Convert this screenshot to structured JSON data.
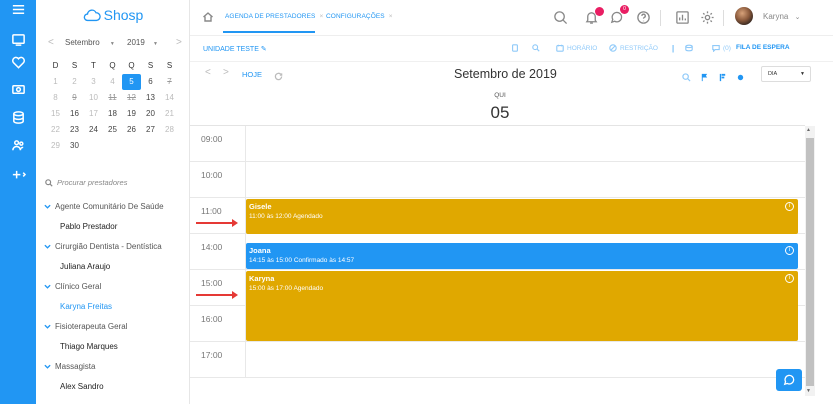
{
  "app": {
    "logo_text": "Shosp",
    "brand_color": "#2196f3"
  },
  "tabs": [
    {
      "label": "AGENDA DE PRESTADORES",
      "close": "×",
      "active": true
    },
    {
      "label": "CONFIGURAÇÕES",
      "close": "×",
      "active": false
    }
  ],
  "user": {
    "name": "Karyna",
    "caret": "⌄"
  },
  "badges": {
    "notifications": "",
    "messages": "0"
  },
  "toolbar": {
    "unit": "UNIDADE TESTE",
    "horario": "HORÁRIO",
    "restricao": "RESTRIÇÃO",
    "sep": "|",
    "waitlist_count": "(0)",
    "fila": "FILA DE ESPERA"
  },
  "nav": {
    "prev": "<",
    "next": ">",
    "today": "HOJE",
    "title": "Setembro de 2019",
    "view": "DIA",
    "view_caret": "▼"
  },
  "day": {
    "dow": "QUI",
    "num": "05"
  },
  "mini_cal": {
    "prev": "<",
    "next": ">",
    "month": "Setembro",
    "month_caret": "▼",
    "year": "2019",
    "year_caret": "▼",
    "dows": [
      "D",
      "S",
      "T",
      "Q",
      "Q",
      "S",
      "S"
    ],
    "weeks": [
      [
        "1",
        "2",
        "3",
        "4",
        "5",
        "6",
        "7"
      ],
      [
        "8",
        "9",
        "10",
        "11",
        "12",
        "13",
        "14"
      ],
      [
        "15",
        "16",
        "17",
        "18",
        "19",
        "20",
        "21"
      ],
      [
        "22",
        "23",
        "24",
        "25",
        "26",
        "27",
        "28"
      ],
      [
        "29",
        "30",
        "",
        "",
        "",
        "",
        ""
      ]
    ]
  },
  "search_placeholder": "Procurar prestadores",
  "providers": [
    {
      "specialty": "Agente Comunitário De Saúde",
      "name": "Pablo Prestador",
      "active": false
    },
    {
      "specialty": "Cirurgião Dentista - Dentística",
      "name": "Juliana Araujo",
      "active": false
    },
    {
      "specialty": "Clínico Geral",
      "name": "Karyna Freitas",
      "active": true
    },
    {
      "specialty": "Fisioterapeuta Geral",
      "name": "Thiago Marques",
      "active": false
    },
    {
      "specialty": "Massagista",
      "name": "Alex Sandro",
      "active": false
    }
  ],
  "times": [
    "09:00",
    "10:00",
    "11:00",
    "14:00",
    "15:00",
    "16:00",
    "17:00"
  ],
  "events": [
    {
      "name": "Gisele",
      "detail": "11:00 às 12:00 Agendado",
      "color": "#e0a800",
      "info": "i"
    },
    {
      "name": "Joana",
      "detail": "14:15 às 15:00 Confirmado às 14:57",
      "color": "#2196f3",
      "info": "i"
    },
    {
      "name": "Karyna",
      "detail": "15:00 às 17:00 Agendado",
      "color": "#e0a800",
      "info": "i"
    }
  ],
  "scroll": {
    "up": "▲",
    "down": "▼"
  }
}
